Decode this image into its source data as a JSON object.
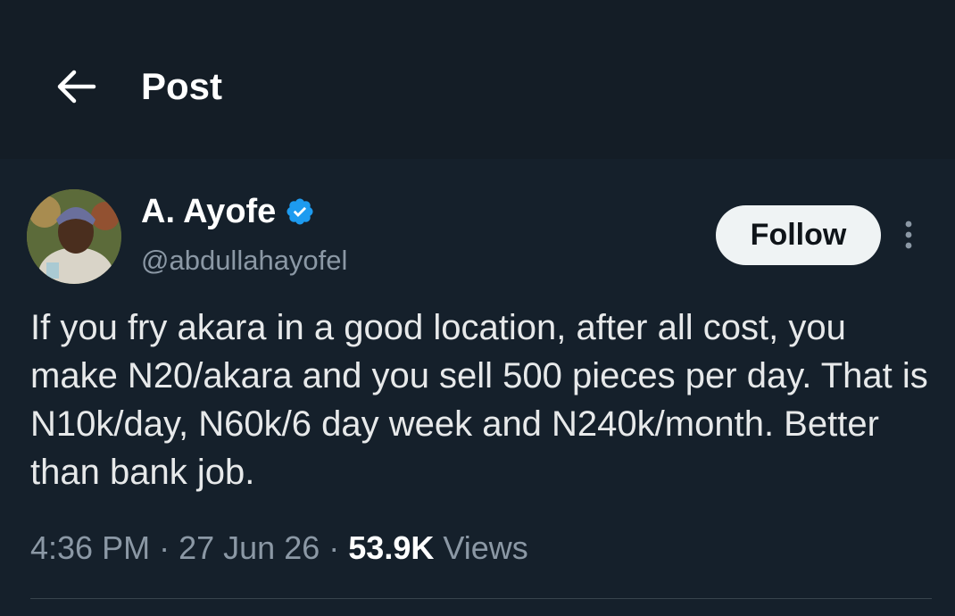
{
  "header": {
    "back_icon": "arrow-left-icon",
    "title": "Post"
  },
  "author": {
    "display_name": "A. Ayofe",
    "verified": true,
    "verified_icon": "verified-badge-icon",
    "handle": "@abdullahayofel"
  },
  "actions": {
    "follow_label": "Follow",
    "more_icon": "more-vertical-icon"
  },
  "post": {
    "text": "If you fry akara in a good location, after all cost, you make N20/akara and you sell 500 pieces per day. That is N10k/day, N60k/6 day week and N240k/month. Better than bank job."
  },
  "meta": {
    "time": "4:36 PM",
    "separator": "·",
    "date": "27 Jun 26",
    "views_count": "53.9K",
    "views_label": "Views"
  },
  "colors": {
    "background": "#15202b",
    "text_primary": "#e7e9ea",
    "text_secondary": "#8b98a5",
    "verified_blue": "#1d9bf0",
    "follow_button_bg": "#eff3f4"
  }
}
